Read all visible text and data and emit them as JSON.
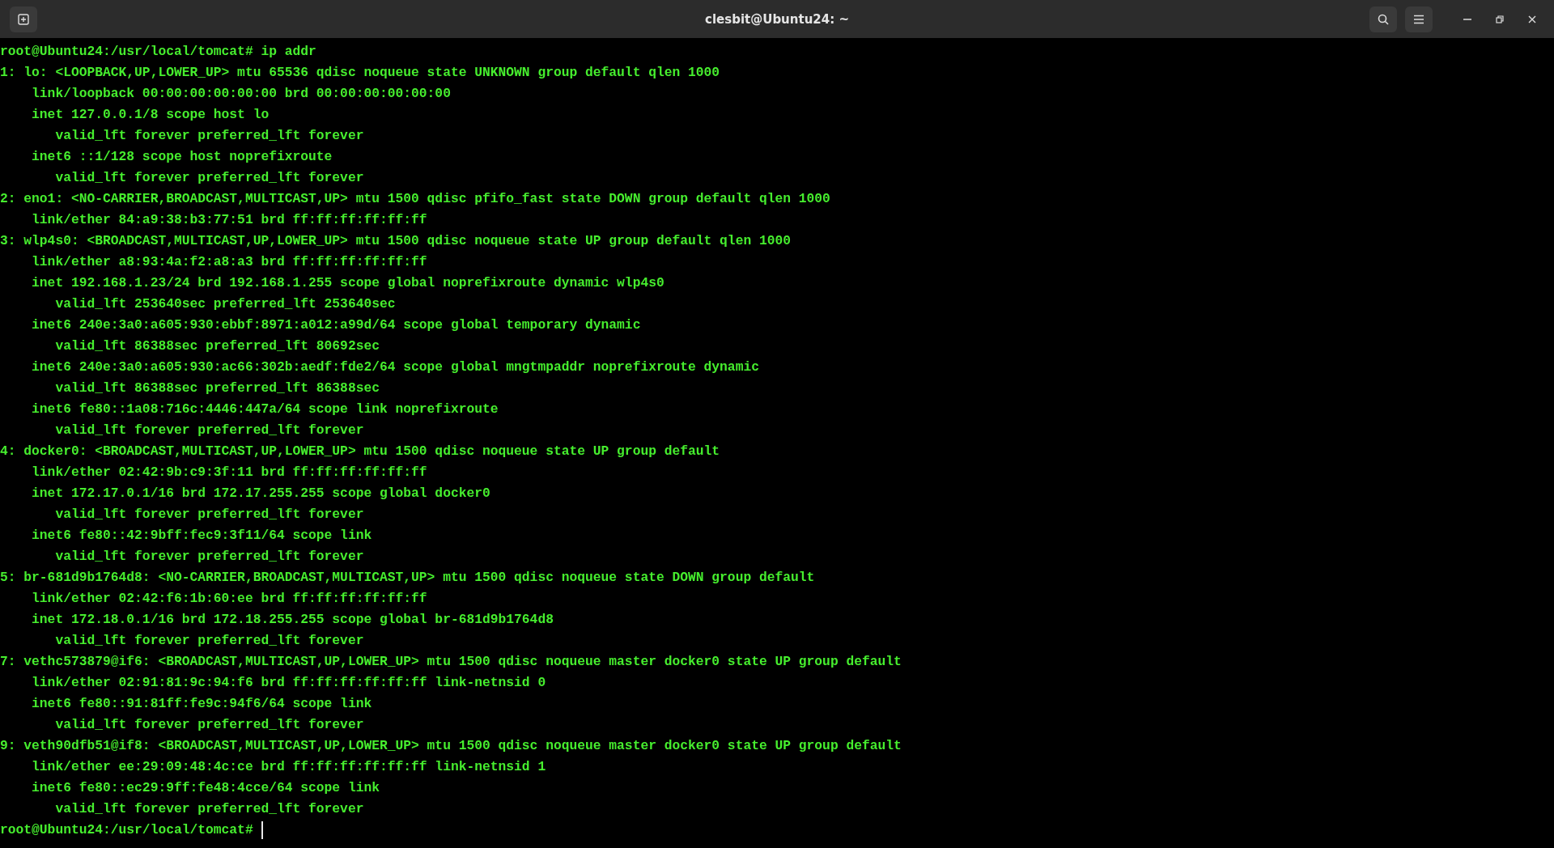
{
  "window": {
    "title": "clesbit@Ubuntu24: ~"
  },
  "terminal": {
    "lines": [
      "root@Ubuntu24:/usr/local/tomcat# ip addr",
      "1: lo: <LOOPBACK,UP,LOWER_UP> mtu 65536 qdisc noqueue state UNKNOWN group default qlen 1000",
      "    link/loopback 00:00:00:00:00:00 brd 00:00:00:00:00:00",
      "    inet 127.0.0.1/8 scope host lo",
      "       valid_lft forever preferred_lft forever",
      "    inet6 ::1/128 scope host noprefixroute",
      "       valid_lft forever preferred_lft forever",
      "2: eno1: <NO-CARRIER,BROADCAST,MULTICAST,UP> mtu 1500 qdisc pfifo_fast state DOWN group default qlen 1000",
      "    link/ether 84:a9:38:b3:77:51 brd ff:ff:ff:ff:ff:ff",
      "3: wlp4s0: <BROADCAST,MULTICAST,UP,LOWER_UP> mtu 1500 qdisc noqueue state UP group default qlen 1000",
      "    link/ether a8:93:4a:f2:a8:a3 brd ff:ff:ff:ff:ff:ff",
      "    inet 192.168.1.23/24 brd 192.168.1.255 scope global noprefixroute dynamic wlp4s0",
      "       valid_lft 253640sec preferred_lft 253640sec",
      "    inet6 240e:3a0:a605:930:ebbf:8971:a012:a99d/64 scope global temporary dynamic",
      "       valid_lft 86388sec preferred_lft 80692sec",
      "    inet6 240e:3a0:a605:930:ac66:302b:aedf:fde2/64 scope global mngtmpaddr noprefixroute dynamic",
      "       valid_lft 86388sec preferred_lft 86388sec",
      "    inet6 fe80::1a08:716c:4446:447a/64 scope link noprefixroute",
      "       valid_lft forever preferred_lft forever",
      "4: docker0: <BROADCAST,MULTICAST,UP,LOWER_UP> mtu 1500 qdisc noqueue state UP group default",
      "    link/ether 02:42:9b:c9:3f:11 brd ff:ff:ff:ff:ff:ff",
      "    inet 172.17.0.1/16 brd 172.17.255.255 scope global docker0",
      "       valid_lft forever preferred_lft forever",
      "    inet6 fe80::42:9bff:fec9:3f11/64 scope link",
      "       valid_lft forever preferred_lft forever",
      "5: br-681d9b1764d8: <NO-CARRIER,BROADCAST,MULTICAST,UP> mtu 1500 qdisc noqueue state DOWN group default",
      "    link/ether 02:42:f6:1b:60:ee brd ff:ff:ff:ff:ff:ff",
      "    inet 172.18.0.1/16 brd 172.18.255.255 scope global br-681d9b1764d8",
      "       valid_lft forever preferred_lft forever",
      "7: vethc573879@if6: <BROADCAST,MULTICAST,UP,LOWER_UP> mtu 1500 qdisc noqueue master docker0 state UP group default",
      "    link/ether 02:91:81:9c:94:f6 brd ff:ff:ff:ff:ff:ff link-netnsid 0",
      "    inet6 fe80::91:81ff:fe9c:94f6/64 scope link",
      "       valid_lft forever preferred_lft forever",
      "9: veth90dfb51@if8: <BROADCAST,MULTICAST,UP,LOWER_UP> mtu 1500 qdisc noqueue master docker0 state UP group default",
      "    link/ether ee:29:09:48:4c:ce brd ff:ff:ff:ff:ff:ff link-netnsid 1",
      "    inet6 fe80::ec29:9ff:fe48:4cce/64 scope link",
      "       valid_lft forever preferred_lft forever"
    ],
    "prompt": "root@Ubuntu24:/usr/local/tomcat#"
  }
}
